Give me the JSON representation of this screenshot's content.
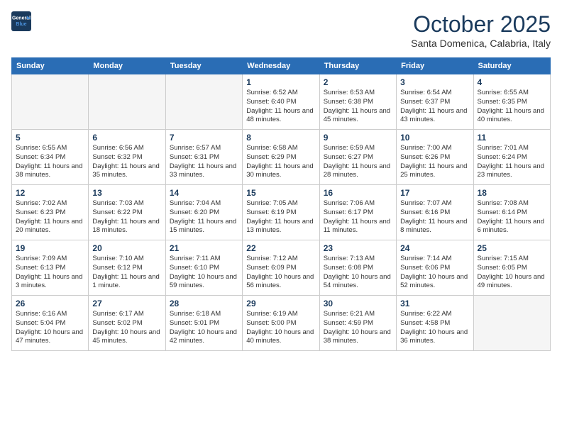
{
  "logo": {
    "line1": "General",
    "line2": "Blue"
  },
  "title": "October 2025",
  "subtitle": "Santa Domenica, Calabria, Italy",
  "days": [
    "Sunday",
    "Monday",
    "Tuesday",
    "Wednesday",
    "Thursday",
    "Friday",
    "Saturday"
  ],
  "weeks": [
    [
      {
        "date": "",
        "text": ""
      },
      {
        "date": "",
        "text": ""
      },
      {
        "date": "",
        "text": ""
      },
      {
        "date": "1",
        "text": "Sunrise: 6:52 AM\nSunset: 6:40 PM\nDaylight: 11 hours and 48 minutes."
      },
      {
        "date": "2",
        "text": "Sunrise: 6:53 AM\nSunset: 6:38 PM\nDaylight: 11 hours and 45 minutes."
      },
      {
        "date": "3",
        "text": "Sunrise: 6:54 AM\nSunset: 6:37 PM\nDaylight: 11 hours and 43 minutes."
      },
      {
        "date": "4",
        "text": "Sunrise: 6:55 AM\nSunset: 6:35 PM\nDaylight: 11 hours and 40 minutes."
      }
    ],
    [
      {
        "date": "5",
        "text": "Sunrise: 6:55 AM\nSunset: 6:34 PM\nDaylight: 11 hours and 38 minutes."
      },
      {
        "date": "6",
        "text": "Sunrise: 6:56 AM\nSunset: 6:32 PM\nDaylight: 11 hours and 35 minutes."
      },
      {
        "date": "7",
        "text": "Sunrise: 6:57 AM\nSunset: 6:31 PM\nDaylight: 11 hours and 33 minutes."
      },
      {
        "date": "8",
        "text": "Sunrise: 6:58 AM\nSunset: 6:29 PM\nDaylight: 11 hours and 30 minutes."
      },
      {
        "date": "9",
        "text": "Sunrise: 6:59 AM\nSunset: 6:27 PM\nDaylight: 11 hours and 28 minutes."
      },
      {
        "date": "10",
        "text": "Sunrise: 7:00 AM\nSunset: 6:26 PM\nDaylight: 11 hours and 25 minutes."
      },
      {
        "date": "11",
        "text": "Sunrise: 7:01 AM\nSunset: 6:24 PM\nDaylight: 11 hours and 23 minutes."
      }
    ],
    [
      {
        "date": "12",
        "text": "Sunrise: 7:02 AM\nSunset: 6:23 PM\nDaylight: 11 hours and 20 minutes."
      },
      {
        "date": "13",
        "text": "Sunrise: 7:03 AM\nSunset: 6:22 PM\nDaylight: 11 hours and 18 minutes."
      },
      {
        "date": "14",
        "text": "Sunrise: 7:04 AM\nSunset: 6:20 PM\nDaylight: 11 hours and 15 minutes."
      },
      {
        "date": "15",
        "text": "Sunrise: 7:05 AM\nSunset: 6:19 PM\nDaylight: 11 hours and 13 minutes."
      },
      {
        "date": "16",
        "text": "Sunrise: 7:06 AM\nSunset: 6:17 PM\nDaylight: 11 hours and 11 minutes."
      },
      {
        "date": "17",
        "text": "Sunrise: 7:07 AM\nSunset: 6:16 PM\nDaylight: 11 hours and 8 minutes."
      },
      {
        "date": "18",
        "text": "Sunrise: 7:08 AM\nSunset: 6:14 PM\nDaylight: 11 hours and 6 minutes."
      }
    ],
    [
      {
        "date": "19",
        "text": "Sunrise: 7:09 AM\nSunset: 6:13 PM\nDaylight: 11 hours and 3 minutes."
      },
      {
        "date": "20",
        "text": "Sunrise: 7:10 AM\nSunset: 6:12 PM\nDaylight: 11 hours and 1 minute."
      },
      {
        "date": "21",
        "text": "Sunrise: 7:11 AM\nSunset: 6:10 PM\nDaylight: 10 hours and 59 minutes."
      },
      {
        "date": "22",
        "text": "Sunrise: 7:12 AM\nSunset: 6:09 PM\nDaylight: 10 hours and 56 minutes."
      },
      {
        "date": "23",
        "text": "Sunrise: 7:13 AM\nSunset: 6:08 PM\nDaylight: 10 hours and 54 minutes."
      },
      {
        "date": "24",
        "text": "Sunrise: 7:14 AM\nSunset: 6:06 PM\nDaylight: 10 hours and 52 minutes."
      },
      {
        "date": "25",
        "text": "Sunrise: 7:15 AM\nSunset: 6:05 PM\nDaylight: 10 hours and 49 minutes."
      }
    ],
    [
      {
        "date": "26",
        "text": "Sunrise: 6:16 AM\nSunset: 5:04 PM\nDaylight: 10 hours and 47 minutes."
      },
      {
        "date": "27",
        "text": "Sunrise: 6:17 AM\nSunset: 5:02 PM\nDaylight: 10 hours and 45 minutes."
      },
      {
        "date": "28",
        "text": "Sunrise: 6:18 AM\nSunset: 5:01 PM\nDaylight: 10 hours and 42 minutes."
      },
      {
        "date": "29",
        "text": "Sunrise: 6:19 AM\nSunset: 5:00 PM\nDaylight: 10 hours and 40 minutes."
      },
      {
        "date": "30",
        "text": "Sunrise: 6:21 AM\nSunset: 4:59 PM\nDaylight: 10 hours and 38 minutes."
      },
      {
        "date": "31",
        "text": "Sunrise: 6:22 AM\nSunset: 4:58 PM\nDaylight: 10 hours and 36 minutes."
      },
      {
        "date": "",
        "text": ""
      }
    ]
  ]
}
